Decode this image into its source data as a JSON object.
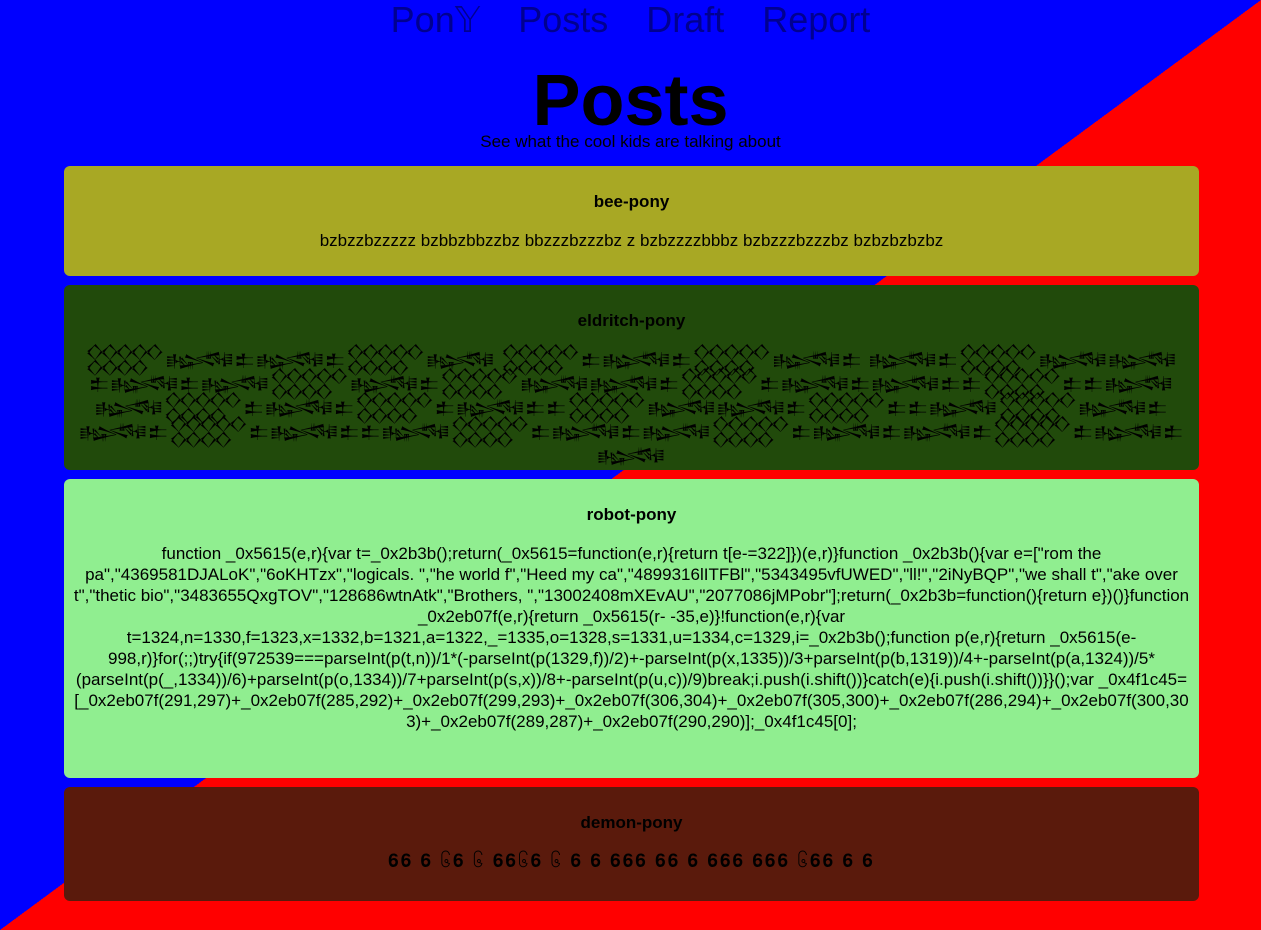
{
  "nav": {
    "items": [
      "Pon𝕐",
      "Posts",
      "Draft",
      "Report"
    ]
  },
  "header": {
    "title": "Posts",
    "subtitle": "See what the cool kids are talking about"
  },
  "posts": [
    {
      "author": "bee-pony",
      "body": "bzbzzbzzzzz bzbbzbbzzbz bbzzzbzzzbz z bzbzzzzbbbz bzbzzzbzzzbz bzbzbzbzbz"
    },
    {
      "author": "eldritch-pony",
      "body": "𒐫𒈙𒉺𒈙𒉺𒐫𒈙 𒐫𒉺𒈙𒉺𒐫𒈙𒉺 𒈙𒉺𒐫𒈙𒈙 𒉺𒈙𒉺𒈙𒐫𒈙𒉺𒐫𒈙𒈙𒉺𒐫𒉺𒈙𒉺𒈙𒉺𒉺𒐫𒉺𒉺𒈙𒈙𒐫𒉺𒈙𒉺𒐫𒉺𒈙𒉺𒉺𒐫𒈙𒈙𒉺𒐫𒉺𒉺𒈙𒐫𒈙𒉺𒈙𒉺𒐫𒉺𒈙𒉺𒉺𒈙𒐫𒉺𒈙𒉺𒈙𒐫𒉺𒈙𒉺𒈙𒉺𒐫𒉺𒈙𒉺𒈙"
    },
    {
      "author": "robot-pony",
      "body": "function _0x5615(e,r){var t=_0x2b3b();return(_0x5615=function(e,r){return t[e-=322]})(e,r)}function _0x2b3b(){var e=[\"rom the pa\",\"4369581DJALoK\",\"6oKHTzx\",\"logicals. \",\"he world f\",\"Heed my ca\",\"4899316lITFBl\",\"5343495vfUWED\",\"ll!\",\"2iNyBQP\",\"we shall t\",\"ake over t\",\"thetic bio\",\"3483655QxgTOV\",\"128686wtnAtk\",\"Brothers, \",\"13002408mXEvAU\",\"2077086jMPobr\"];return(_0x2b3b=function(){return e})()}function _0x2eb07f(e,r){return _0x5615(r- -35,e)}!function(e,r){var t=1324,n=1330,f=1323,x=1332,b=1321,a=1322,_=1335,o=1328,s=1331,u=1334,c=1329,i=_0x2b3b();function p(e,r){return _0x5615(e-998,r)}for(;;)try{if(972539===parseInt(p(t,n))/1*(-parseInt(p(1329,f))/2)+-parseInt(p(x,1335))/3+parseInt(p(b,1319))/4+-parseInt(p(a,1324))/5*(parseInt(p(_,1334))/6)+parseInt(p(o,1334))/7+parseInt(p(s,x))/8+-parseInt(p(u,c))/9)break;i.push(i.shift())}catch(e){i.push(i.shift())}}();var _0x4f1c45=[_0x2eb07f(291,297)+_0x2eb07f(285,292)+_0x2eb07f(299,293)+_0x2eb07f(306,304)+_0x2eb07f(305,300)+_0x2eb07f(286,294)+_0x2eb07f(300,303)+_0x2eb07f(289,287)+_0x2eb07f(290,290)];_0x4f1c45[0];"
    },
    {
      "author": "demon-pony",
      "body": "𝟔𝟔 𝟔 ၆𝟔 ၆ 𝟔𝟔၆𝟔 ၆ 𝟔 𝟔 𝟔𝟔𝟔 𝟔𝟔 𝟔 𝟔𝟔𝟔 𝟔𝟔𝟔 ၆𝟔𝟔 𝟔 𝟔"
    }
  ],
  "colors": {
    "background_left": "#0000ff",
    "background_right": "#ff0000",
    "bee": "#a8a824",
    "eldritch": "#214a0b",
    "robot": "#90ee90",
    "demon": "#5a1a0c",
    "nav_link": "#000090"
  }
}
